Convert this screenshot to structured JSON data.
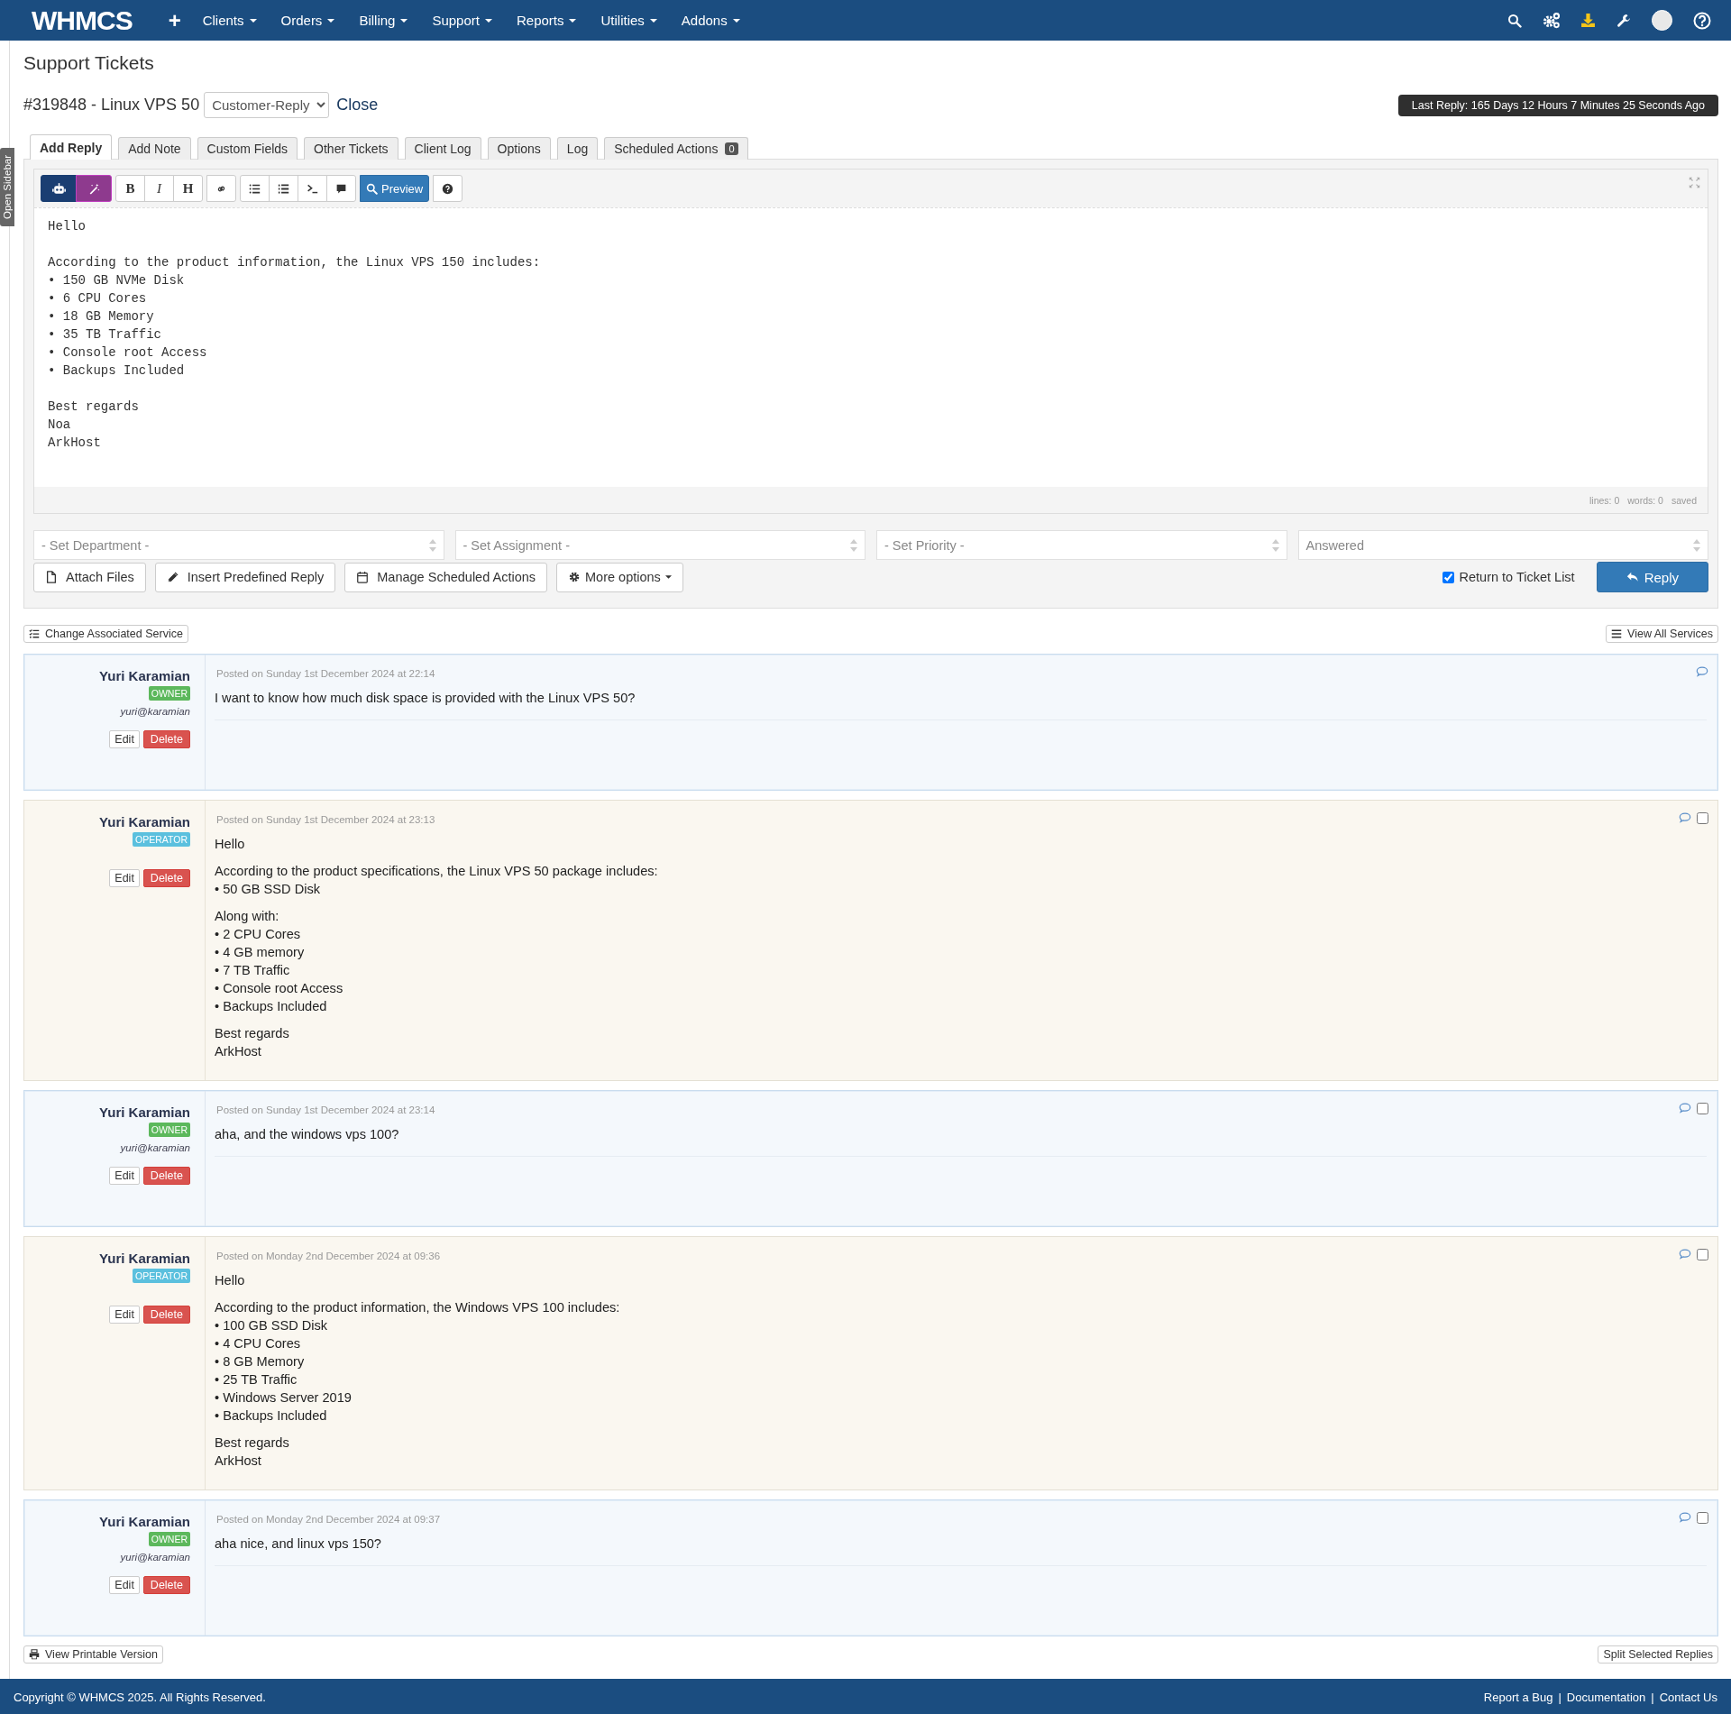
{
  "nav": {
    "logo": "WHMCS",
    "plus": "+",
    "menus": [
      {
        "label": "Clients"
      },
      {
        "label": "Orders"
      },
      {
        "label": "Billing"
      },
      {
        "label": "Support"
      },
      {
        "label": "Reports"
      },
      {
        "label": "Utilities"
      },
      {
        "label": "Addons"
      }
    ]
  },
  "sidebar_toggle": "Open Sidebar",
  "page_title": "Support Tickets",
  "ticket": {
    "title": "#319848 - Linux VPS 50",
    "status": "Customer-Reply",
    "close": "Close",
    "last_reply": "Last Reply: 165 Days 12 Hours 7 Minutes 25 Seconds Ago"
  },
  "tabs": [
    {
      "label": "Add Reply",
      "selected": true
    },
    {
      "label": "Add Note",
      "selected": false
    },
    {
      "label": "Custom Fields",
      "selected": false
    },
    {
      "label": "Other Tickets",
      "selected": false
    },
    {
      "label": "Client Log",
      "selected": false
    },
    {
      "label": "Options",
      "selected": false
    },
    {
      "label": "Log",
      "selected": false
    },
    {
      "label": "Scheduled Actions",
      "badge": "0",
      "selected": false
    }
  ],
  "editor": {
    "toolbar": [
      [
        {
          "kind": "ai"
        },
        {
          "kind": "magic"
        }
      ],
      [
        {
          "kind": "bold",
          "label": "B"
        },
        {
          "kind": "italic",
          "label": "I"
        },
        {
          "kind": "heading",
          "label": "H"
        }
      ],
      [
        {
          "kind": "link"
        }
      ],
      [
        {
          "kind": "list"
        },
        {
          "kind": "numbered"
        },
        {
          "kind": "code"
        },
        {
          "kind": "quote"
        }
      ],
      [
        {
          "kind": "preview",
          "label": "Preview"
        }
      ],
      [
        {
          "kind": "help"
        }
      ]
    ],
    "text": "Hello\n\nAccording to the product information, the Linux VPS 150 includes:\n• 150 GB NVMe Disk\n• 6 CPU Cores\n• 18 GB Memory\n• 35 TB Traffic\n• Console root Access\n• Backups Included\n\nBest regards\nNoa\nArkHost",
    "status": [
      "lines: 0",
      "words: 0",
      "saved"
    ]
  },
  "selects": [
    {
      "value": "- Set Department -"
    },
    {
      "value": "- Set Assignment -"
    },
    {
      "value": "- Set Priority -"
    },
    {
      "value": "Answered"
    }
  ],
  "actions": [
    {
      "kind": "file",
      "label": "Attach Files"
    },
    {
      "kind": "pencil",
      "label": "Insert Predefined Reply"
    },
    {
      "kind": "calendar",
      "label": "Manage Scheduled Actions"
    },
    {
      "kind": "menu",
      "label": "More options"
    }
  ],
  "return_to_list": {
    "label": "Return to Ticket List",
    "checked": true
  },
  "reply_button": "Reply",
  "change_service": "Change Associated Service",
  "view_all_services": "View All Services",
  "posts": [
    {
      "kind": "owner",
      "name": "Yuri Karamian",
      "role": "OWNER",
      "email": "yuri@karamian",
      "edit": "Edit",
      "delete": "Delete",
      "date": "Posted on Sunday 1st December 2024 at 22:14",
      "paragraphs": [
        "I want to know how much disk space is provided with the Linux VPS 50?"
      ]
    },
    {
      "kind": "operator",
      "name": "Yuri Karamian",
      "role": "OPERATOR",
      "edit": "Edit",
      "delete": "Delete",
      "date": "Posted on Sunday 1st December 2024 at 23:13",
      "checkbox": {
        "checked": false
      },
      "paragraphs": [
        "Hello",
        "According to the product specifications, the Linux VPS 50 package includes:\n• 50 GB SSD Disk",
        "Along with:\n• 2 CPU Cores\n• 4 GB memory\n• 7 TB Traffic\n• Console root Access\n• Backups Included",
        "Best regards\nArkHost"
      ]
    },
    {
      "kind": "owner",
      "name": "Yuri Karamian",
      "role": "OWNER",
      "email": "yuri@karamian",
      "edit": "Edit",
      "delete": "Delete",
      "date": "Posted on Sunday 1st December 2024 at 23:14",
      "checkbox": {
        "checked": false
      },
      "paragraphs": [
        "aha, and the windows vps 100?"
      ]
    },
    {
      "kind": "operator",
      "name": "Yuri Karamian",
      "role": "OPERATOR",
      "edit": "Edit",
      "delete": "Delete",
      "date": "Posted on Monday 2nd December 2024 at 09:36",
      "checkbox": {
        "checked": false
      },
      "paragraphs": [
        "Hello",
        "According to the product information, the Windows VPS 100 includes:\n• 100 GB SSD Disk\n• 4 CPU Cores\n• 8 GB Memory\n• 25 TB Traffic\n• Windows Server 2019\n• Backups Included",
        "Best regards\nArkHost"
      ]
    },
    {
      "kind": "owner",
      "name": "Yuri Karamian",
      "role": "OWNER",
      "email": "yuri@karamian",
      "edit": "Edit",
      "delete": "Delete",
      "date": "Posted on Monday 2nd December 2024 at 09:37",
      "checkbox": {
        "checked": false
      },
      "paragraphs": [
        "aha nice, and linux vps 150?"
      ]
    }
  ],
  "print": "View Printable Version",
  "split": "Split Selected Replies",
  "footer": {
    "copyright": "Copyright © WHMCS 2025. All Rights Reserved.",
    "separator": "|",
    "links": [
      "Report a Bug",
      "Documentation",
      "Contact Us"
    ]
  }
}
